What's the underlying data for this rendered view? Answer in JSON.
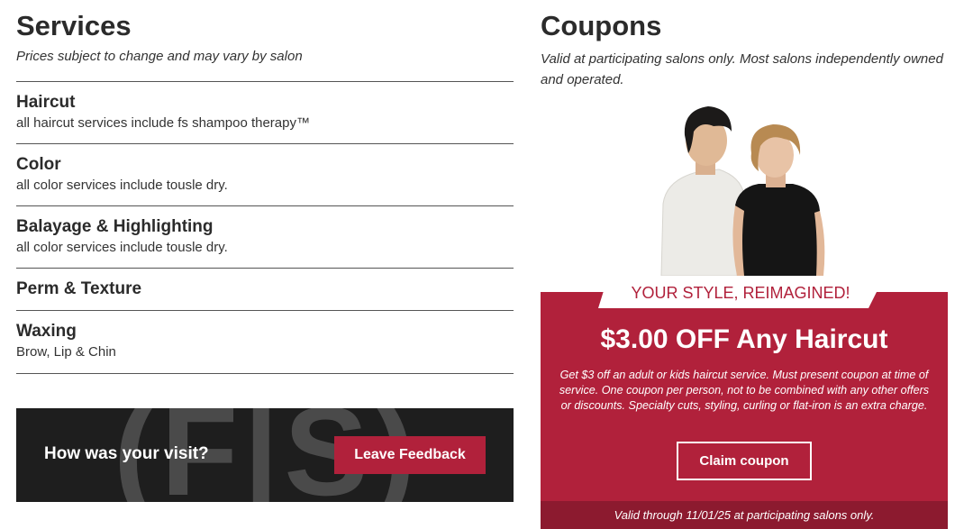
{
  "services": {
    "title": "Services",
    "note": "Prices subject to change and may vary by salon",
    "items": [
      {
        "name": "Haircut",
        "desc": "all haircut services include fs shampoo therapy™"
      },
      {
        "name": "Color",
        "desc": "all color services include tousle dry."
      },
      {
        "name": "Balayage & Highlighting",
        "desc": "all color services include tousle dry."
      },
      {
        "name": "Perm & Texture",
        "desc": ""
      },
      {
        "name": "Waxing",
        "desc": "Brow, Lip & Chin"
      }
    ]
  },
  "feedback": {
    "question": "How was your visit?",
    "button_label": "Leave Feedback",
    "watermark": "(F|S)"
  },
  "coupons": {
    "title": "Coupons",
    "note": "Valid at participating salons only. Most salons independently owned and operated.",
    "ribbon": "YOUR STYLE, REIMAGINED!",
    "offer": "$3.00 OFF Any Haircut",
    "terms": "Get $3 off an adult or kids haircut service. Must present coupon at time of service. One coupon per person, not to be combined with any other offers or discounts. Specialty cuts, styling, curling or flat-iron is an extra charge.",
    "claim_label": "Claim coupon",
    "valid": "Valid through 11/01/25 at participating salons only."
  },
  "colors": {
    "brand_red": "#b1213b",
    "dark_red": "#8c1a2f",
    "dark_panel": "#1e1e1e"
  }
}
